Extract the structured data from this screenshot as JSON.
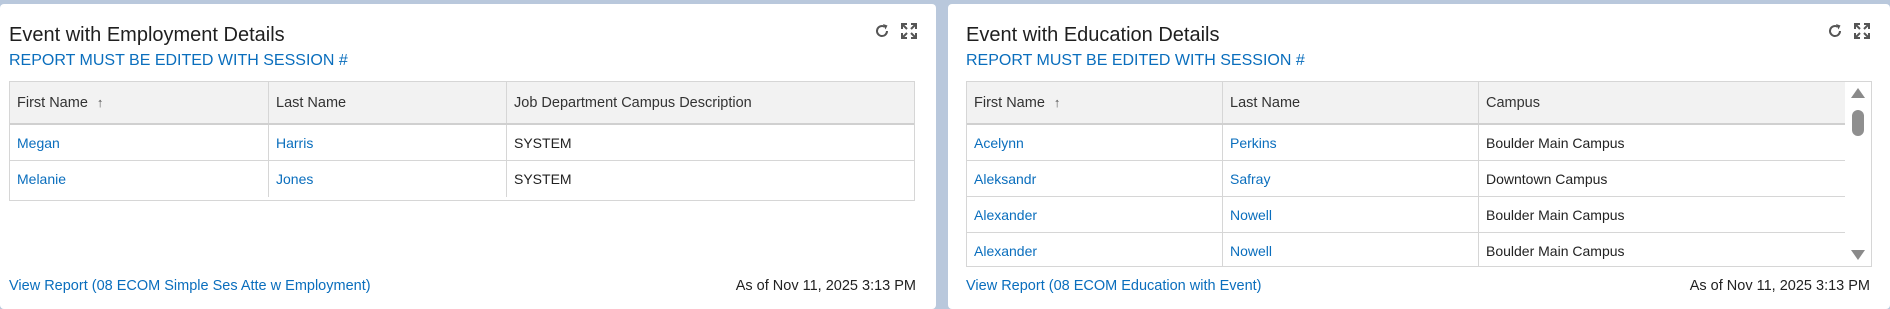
{
  "left_panel": {
    "title": "Event with Employment Details",
    "subtitle": "REPORT MUST BE EDITED WITH SESSION #",
    "columns": [
      "First Name",
      "Last Name",
      "Job Department Campus Description"
    ],
    "sort_icon": "arrow-up-icon",
    "rows": [
      {
        "first": "Megan",
        "last": "Harris",
        "desc": "SYSTEM"
      },
      {
        "first": "Melanie",
        "last": "Jones",
        "desc": "SYSTEM"
      }
    ],
    "footer_link": "View Report (08 ECOM Simple Ses Atte w Employment)",
    "timestamp": "As of Nov 11, 2025 3:13 PM"
  },
  "right_panel": {
    "title": "Event with Education Details",
    "subtitle": "REPORT MUST BE EDITED WITH SESSION #",
    "columns": [
      "First Name",
      "Last Name",
      "Campus"
    ],
    "sort_icon": "arrow-up-icon",
    "rows": [
      {
        "first": "Acelynn",
        "last": "Perkins",
        "campus": "Boulder Main Campus"
      },
      {
        "first": "Aleksandr",
        "last": "Safray",
        "campus": "Downtown Campus"
      },
      {
        "first": "Alexander",
        "last": "Nowell",
        "campus": "Boulder Main Campus"
      },
      {
        "first": "Alexander",
        "last": "Nowell",
        "campus": "Boulder Main Campus"
      }
    ],
    "footer_link": "View Report (08 ECOM Education with Event)",
    "timestamp": "As of Nov 11, 2025 3:13 PM"
  },
  "icons": {
    "refresh": "refresh-icon",
    "expand": "expand-icon"
  },
  "colors": {
    "link": "#0a6ebd",
    "background": "#b9c8dc",
    "header_bg": "#f2f2f2"
  }
}
